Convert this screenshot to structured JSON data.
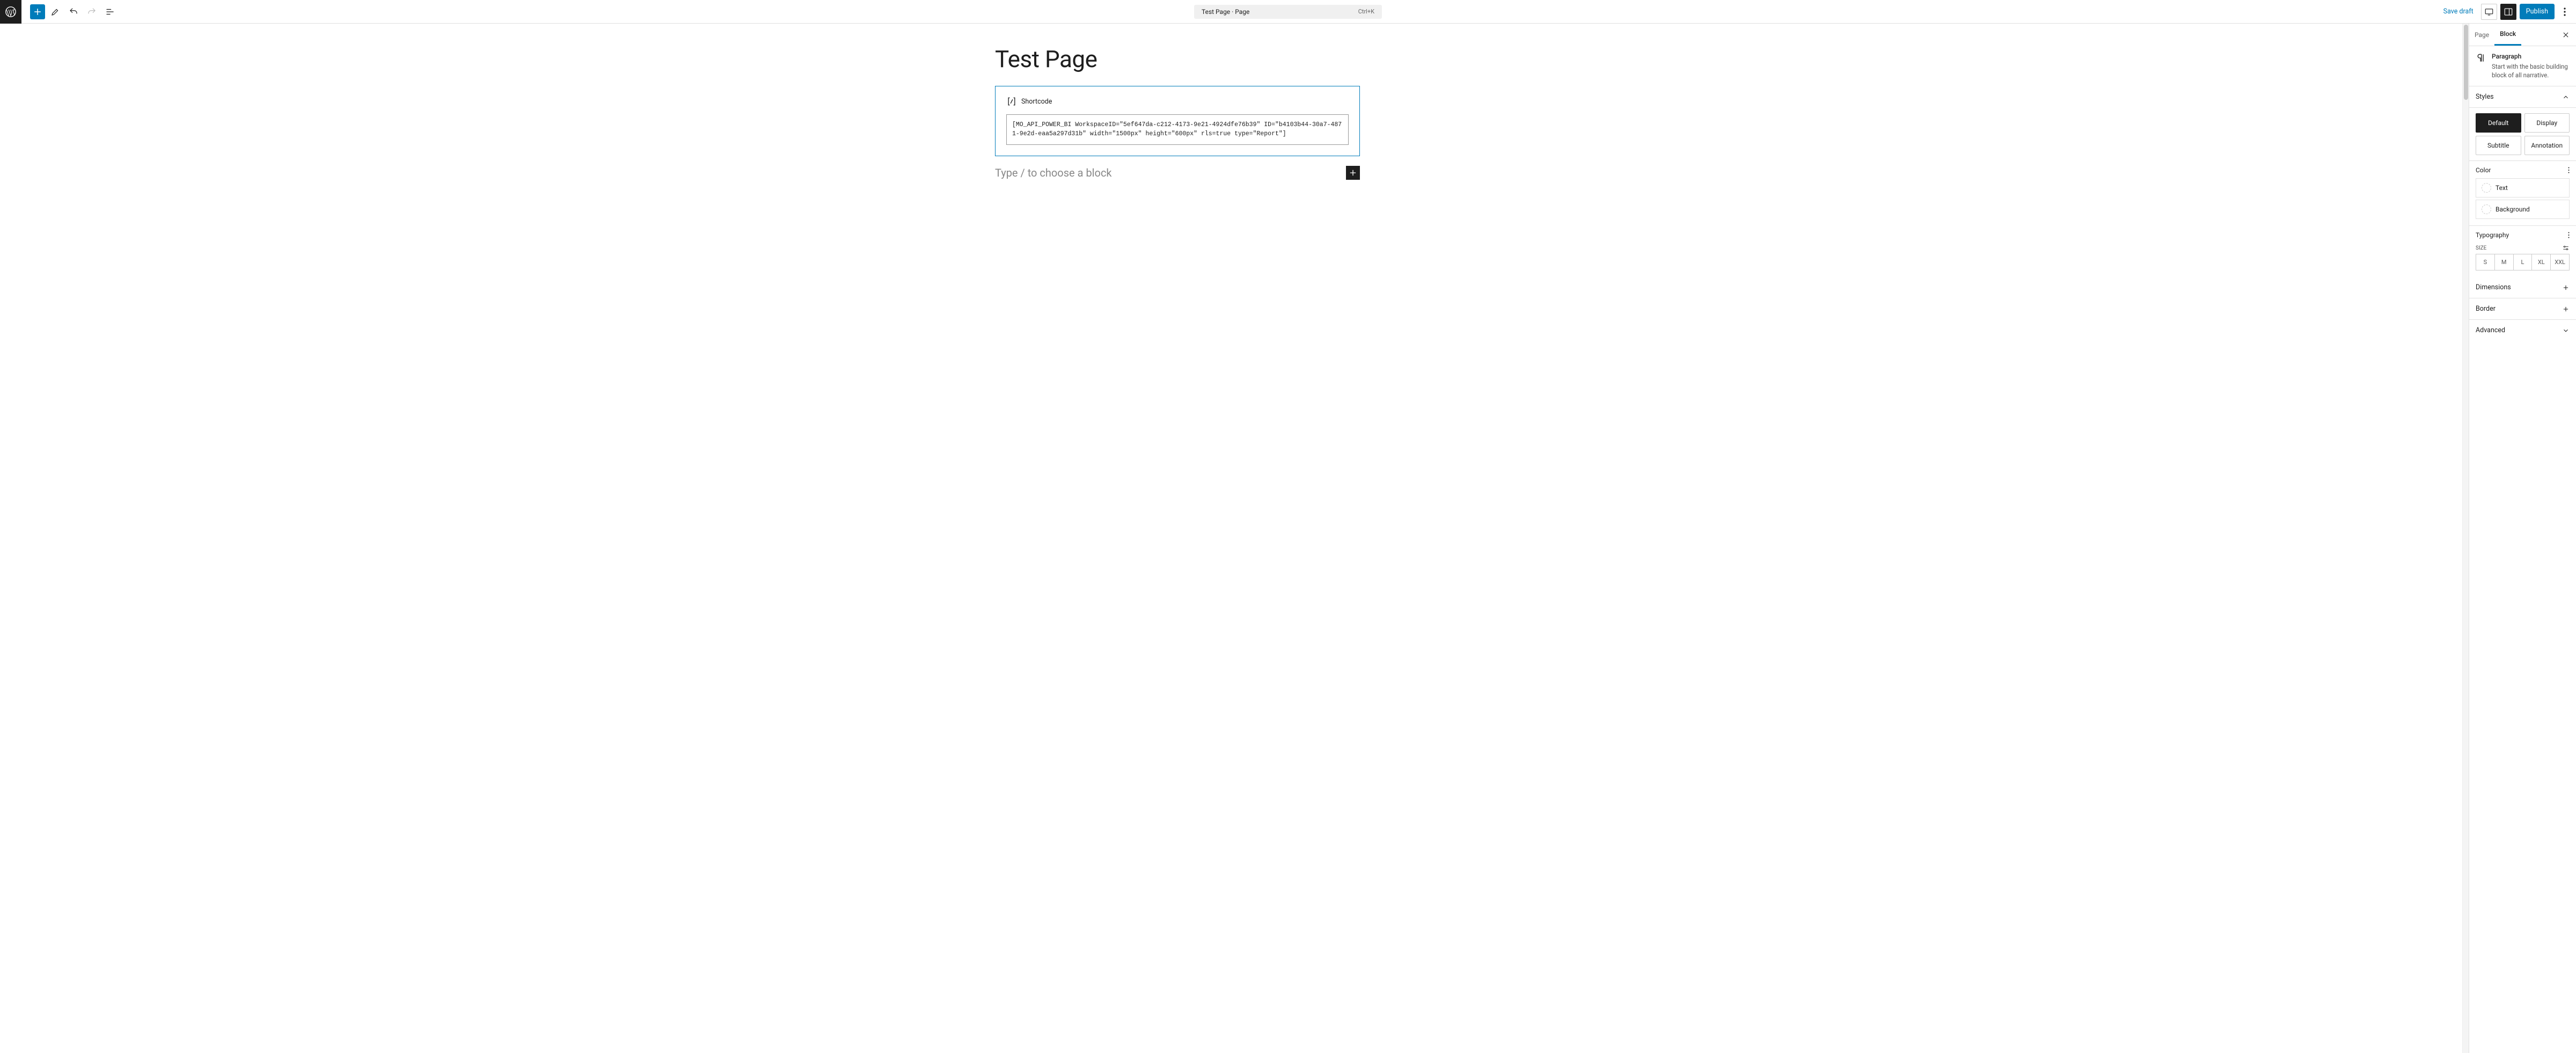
{
  "toolbar": {
    "doc_title": "Test Page · Page",
    "shortcut": "Ctrl+K",
    "save_draft": "Save draft",
    "publish": "Publish"
  },
  "editor": {
    "page_title": "Test Page",
    "shortcode_label": "Shortcode",
    "shortcode_value": "[MO_API_POWER_BI WorkspaceID=\"5ef647da-c212-4173-9e21-4924dfe76b39\" ID=\"b4103b44-30a7-4871-9e2d-eaa5a297d31b\" width=\"1500px\" height=\"600px\" rls=true type=\"Report\"]",
    "placeholder": "Type / to choose a block"
  },
  "sidebar": {
    "tabs": {
      "page": "Page",
      "block": "Block"
    },
    "block_type": {
      "name": "Paragraph",
      "description": "Start with the basic building block of all narrative."
    },
    "styles": {
      "header": "Styles",
      "options": [
        "Default",
        "Display",
        "Subtitle",
        "Annotation"
      ]
    },
    "color": {
      "header": "Color",
      "text": "Text",
      "background": "Background"
    },
    "typography": {
      "header": "Typography",
      "size_label": "SIZE",
      "sizes": [
        "S",
        "M",
        "L",
        "XL",
        "XXL"
      ]
    },
    "dimensions": "Dimensions",
    "border": "Border",
    "advanced": "Advanced"
  }
}
